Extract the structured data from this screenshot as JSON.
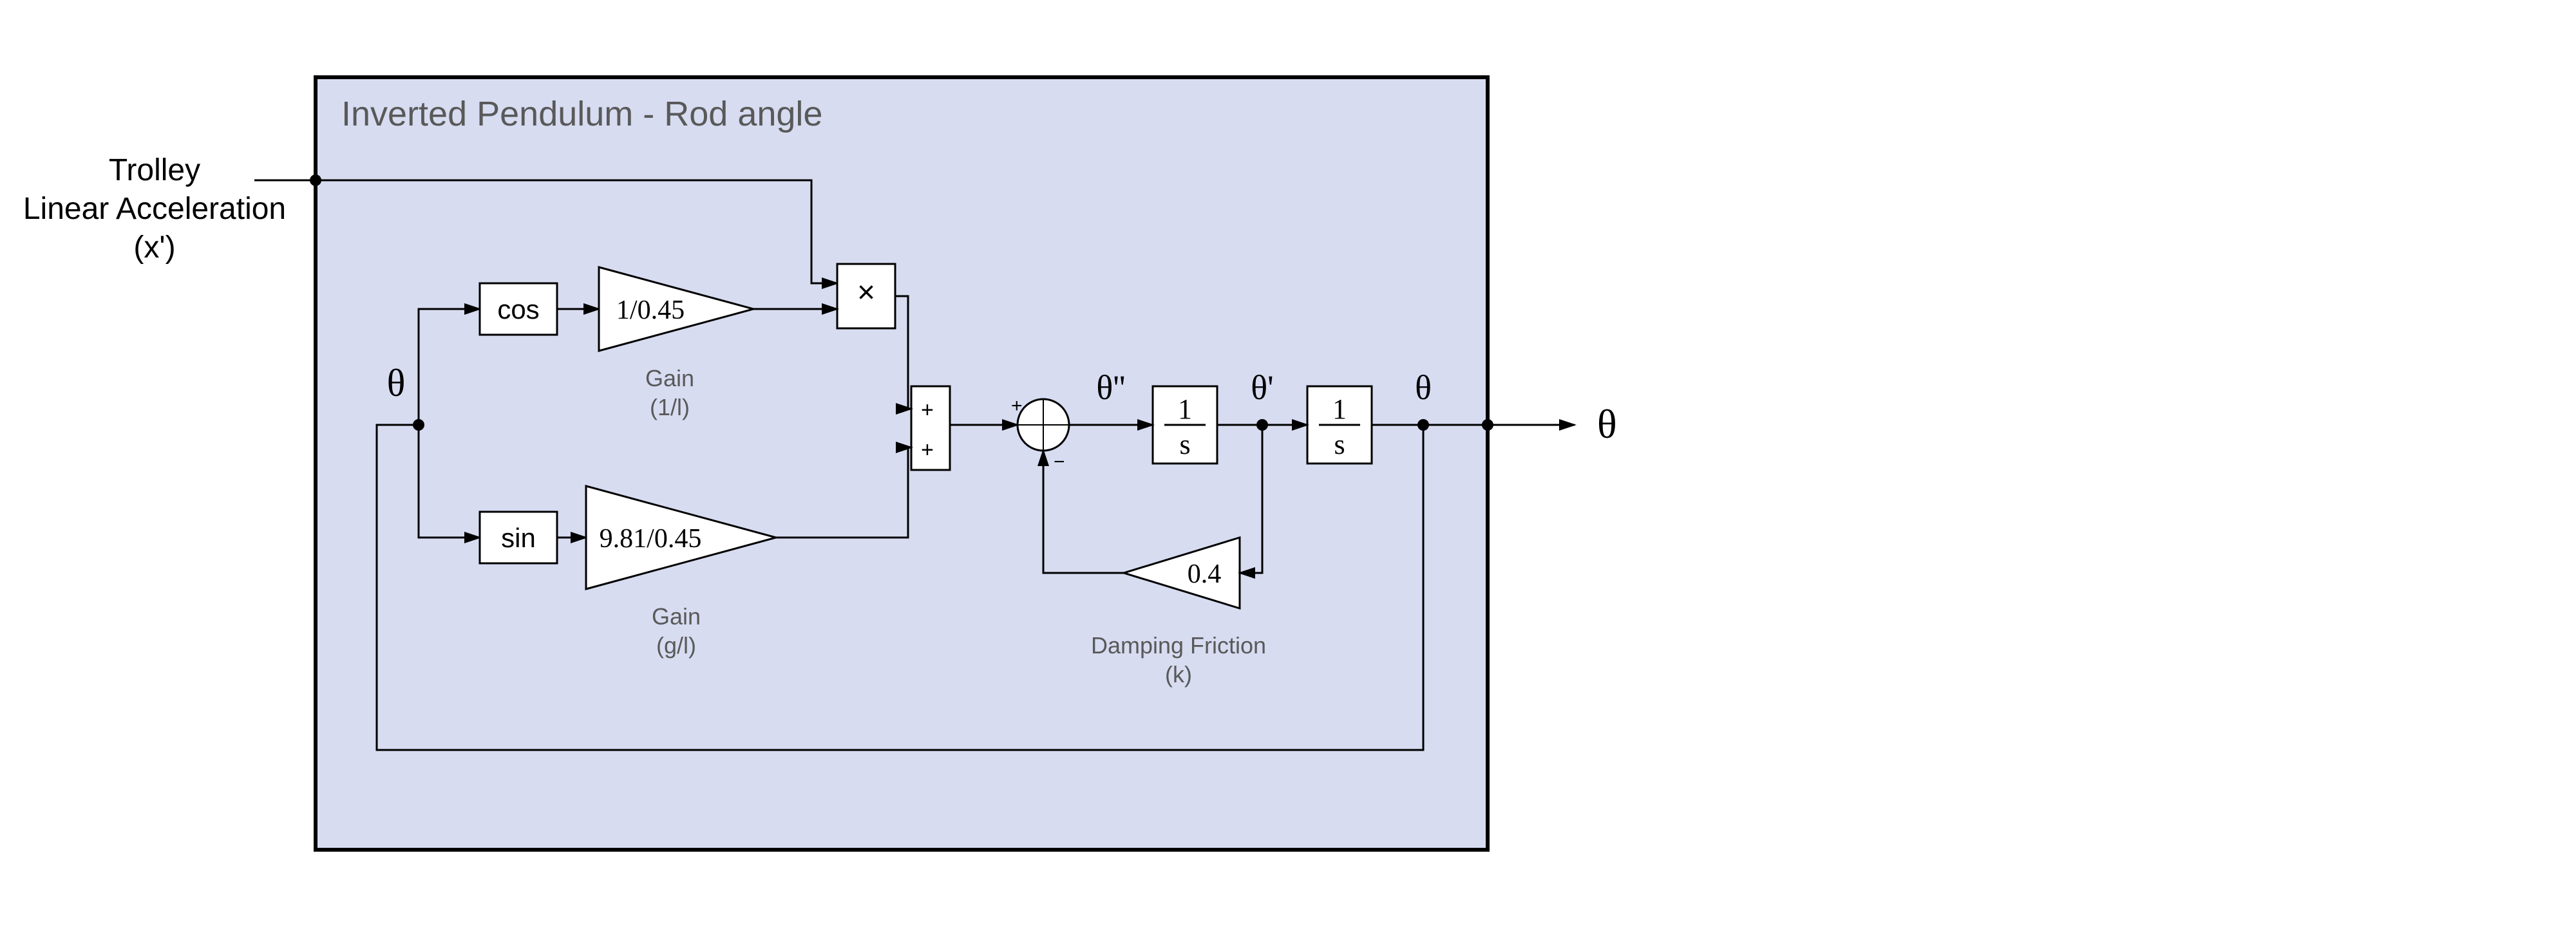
{
  "title": "Inverted Pendulum - Rod angle",
  "input": {
    "line1": "Trolley",
    "line2": "Linear Acceleration",
    "line3": "(x')"
  },
  "blocks": {
    "theta_in": "θ",
    "cos": "cos",
    "sin": "sin",
    "gain1": {
      "value": "1/0.45",
      "label1": "Gain",
      "label2": "(1/l)"
    },
    "gain2": {
      "value": "9.81/0.45",
      "label1": "Gain",
      "label2": "(g/l)"
    },
    "mult": "×",
    "sum1": {
      "s1": "+",
      "s2": "+"
    },
    "sum2": {
      "s1": "+",
      "s2": "−"
    },
    "theta_dd": "θ''",
    "int1": {
      "num": "1",
      "den": "s"
    },
    "theta_d": "θ'",
    "int2": {
      "num": "1",
      "den": "s"
    },
    "theta_out": "θ",
    "damp": {
      "value": "0.4",
      "label1": "Damping Friction",
      "label2": "(k)"
    }
  },
  "output": "θ"
}
